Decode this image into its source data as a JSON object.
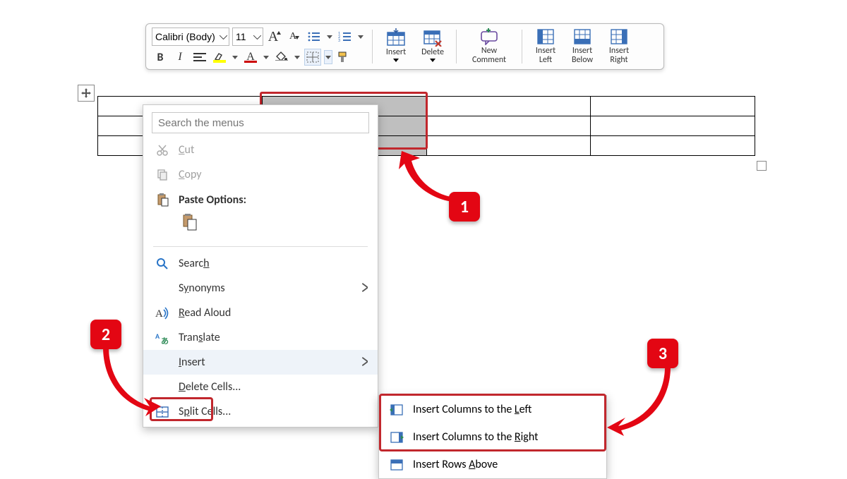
{
  "toolbar": {
    "font_name": "Calibri (Body)",
    "font_size": "11",
    "buttons": {
      "grow_font": "A",
      "shrink_font": "A",
      "bold": "B",
      "italic": "I"
    },
    "big": {
      "insert": "Insert",
      "delete": "Delete",
      "new_comment_line1": "New",
      "new_comment_line2": "Comment",
      "insert_left_line1": "Insert",
      "insert_left_line2": "Left",
      "insert_below_line1": "Insert",
      "insert_below_line2": "Below",
      "insert_right_line1": "Insert",
      "insert_right_line2": "Right"
    }
  },
  "context_menu": {
    "search_placeholder": "Search the menus",
    "cut": "Cut",
    "copy": "Copy",
    "paste_options": "Paste Options:",
    "search": "Search",
    "synonyms": "Synonyms",
    "read_aloud": "Read Aloud",
    "translate": "Translate",
    "insert": "Insert",
    "delete_cells": "Delete Cells...",
    "split_cells": "Split Cells..."
  },
  "submenu": {
    "cols_left": "Insert Columns to the Left",
    "cols_right": "Insert Columns to the Right",
    "rows_above": "Insert Rows Above"
  },
  "callouts": {
    "one": "1",
    "two": "2",
    "three": "3"
  }
}
